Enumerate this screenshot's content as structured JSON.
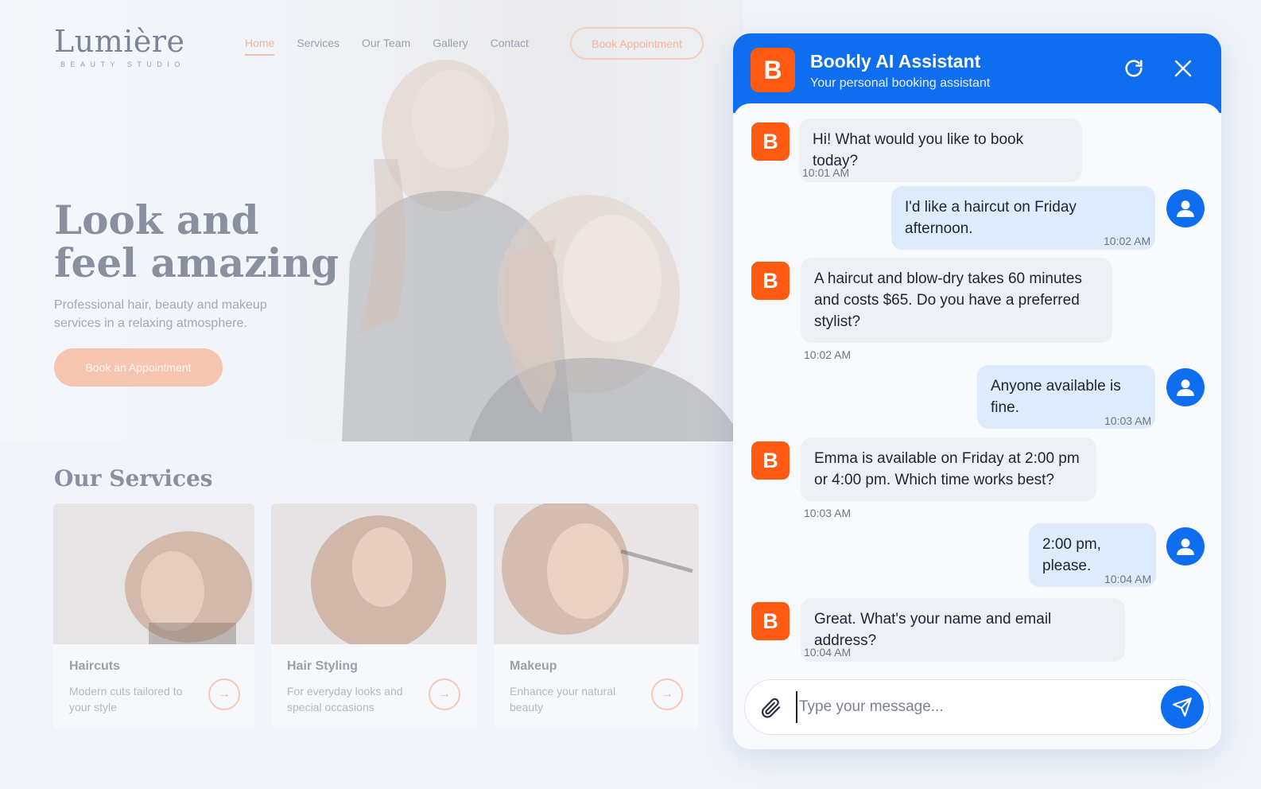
{
  "site": {
    "logo": {
      "name": "Lumière",
      "tagline": "BEAUTY STUDIO"
    },
    "nav": [
      "Home",
      "Services",
      "Our Team",
      "Gallery",
      "Contact"
    ],
    "nav_cta": "Book Appointment",
    "hero": {
      "title_line1": "Look and",
      "title_line2": "feel amazing",
      "subtitle": "Professional hair, beauty and makeup services in a relaxing atmosphere.",
      "button": "Book an Appointment"
    },
    "services_title": "Our Services",
    "services": [
      {
        "name": "Haircuts",
        "desc": "Modern cuts tailored to your style"
      },
      {
        "name": "Hair Styling",
        "desc": "For everyday looks and special occasions"
      },
      {
        "name": "Makeup",
        "desc": "Enhance your natural beauty"
      }
    ]
  },
  "chat": {
    "avatar_letter": "B",
    "title": "Bookly AI Assistant",
    "subtitle": "Your personal booking assistant",
    "messages": [
      {
        "from": "bot",
        "text": "Hi! What would you like to book today?",
        "time": "10:01 AM"
      },
      {
        "from": "user",
        "text": "I'd like a haircut on Friday afternoon.",
        "time": "10:02 AM"
      },
      {
        "from": "bot",
        "text": "A haircut and blow-dry takes 60 minutes and costs $65. Do you have a preferred stylist?",
        "time": "10:02 AM"
      },
      {
        "from": "user",
        "text": "Anyone available is fine.",
        "time": "10:03 AM"
      },
      {
        "from": "bot",
        "text": "Emma is available on Friday at 2:00 pm or 4:00 pm. Which time works best?",
        "time": "10:03 AM"
      },
      {
        "from": "user",
        "text": "2:00 pm, please.",
        "time": "10:04 AM"
      },
      {
        "from": "bot",
        "text": "Great. What's your name and email address?",
        "time": "10:04 AM"
      }
    ],
    "input_placeholder": "Type your message...",
    "colors": {
      "primary": "#0f6ef0",
      "brand": "#ff5a12"
    }
  }
}
